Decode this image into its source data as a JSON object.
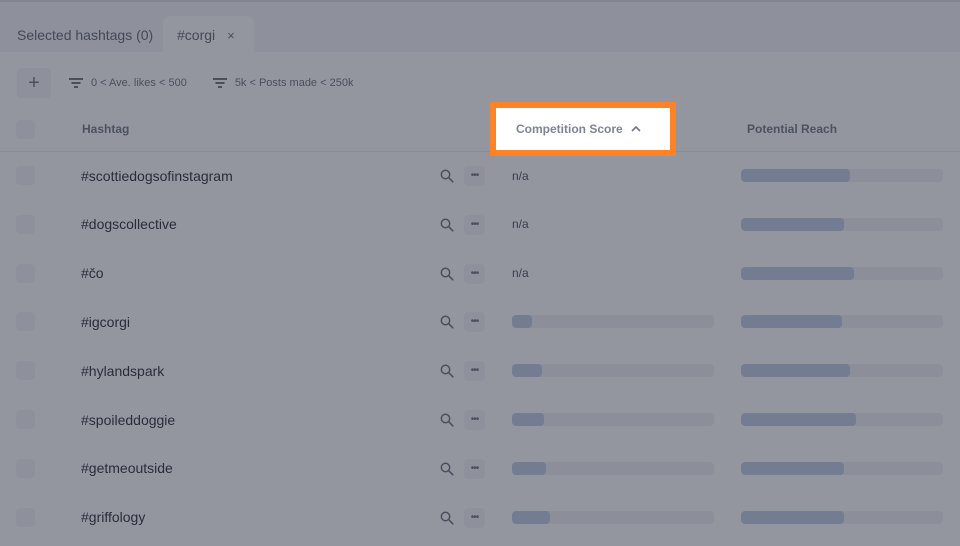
{
  "tabs": [
    {
      "label": "Selected hashtags (0)",
      "active": false
    },
    {
      "label": "#corgi",
      "active": true,
      "close_icon": "×"
    }
  ],
  "toolbar": {
    "add_label": "+",
    "filters": [
      {
        "icon": "filter-icon",
        "label": "0 < Ave. likes < 500"
      },
      {
        "icon": "filter-icon",
        "label": "5k < Posts made < 250k"
      }
    ]
  },
  "table": {
    "columns": {
      "hashtag": "Hashtag",
      "competition": "Competition Score",
      "competition_sort_icon": "^",
      "reach": "Potential Reach"
    },
    "rows": [
      {
        "hashtag": "#scottiedogsofinstagram",
        "competition": "n/a",
        "competition_fraction": null,
        "reach_fraction": 0.54
      },
      {
        "hashtag": "#dogscollective",
        "competition": "n/a",
        "competition_fraction": null,
        "reach_fraction": 0.51
      },
      {
        "hashtag": "#čo",
        "competition": "n/a",
        "competition_fraction": null,
        "reach_fraction": 0.56
      },
      {
        "hashtag": "#igcorgi",
        "competition": null,
        "competition_fraction": 0.1,
        "reach_fraction": 0.5
      },
      {
        "hashtag": "#hylandspark",
        "competition": null,
        "competition_fraction": 0.15,
        "reach_fraction": 0.54
      },
      {
        "hashtag": "#spoileddoggie",
        "competition": null,
        "competition_fraction": 0.16,
        "reach_fraction": 0.57
      },
      {
        "hashtag": "#getmeoutside",
        "competition": null,
        "competition_fraction": 0.17,
        "reach_fraction": 0.51
      },
      {
        "hashtag": "#griffology",
        "competition": null,
        "competition_fraction": 0.19,
        "reach_fraction": 0.51
      }
    ]
  },
  "colors": {
    "highlight_border": "#ff8227",
    "bar_fill": "#b9c6de",
    "bar_track": "#e8eaee"
  }
}
